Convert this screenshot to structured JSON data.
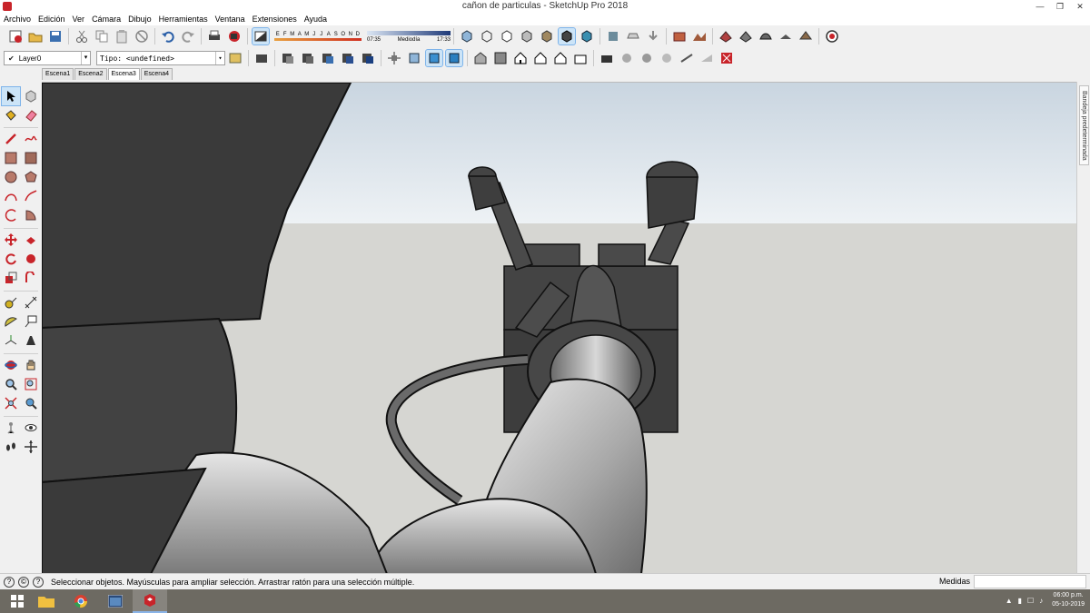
{
  "window": {
    "title": "cañon de particulas - SketchUp Pro 2018"
  },
  "menu": [
    "Archivo",
    "Edición",
    "Ver",
    "Cámara",
    "Dibujo",
    "Herramientas",
    "Ventana",
    "Extensiones",
    "Ayuda"
  ],
  "shadows": {
    "months": [
      "E",
      "F",
      "M",
      "A",
      "M",
      "J",
      "J",
      "A",
      "S",
      "O",
      "N",
      "D"
    ],
    "time_start": "07:35",
    "time_mid": "Mediodía",
    "time_end": "17:33"
  },
  "layer": {
    "current": "Layer0"
  },
  "type_field": {
    "value": "Tipo: <undefined>"
  },
  "scenes": [
    {
      "label": "Escena1",
      "active": false
    },
    {
      "label": "Escena2",
      "active": false
    },
    {
      "label": "Escena3",
      "active": true
    },
    {
      "label": "Escena4",
      "active": false
    }
  ],
  "tray": {
    "label": "Bandeja predeterminada"
  },
  "status": {
    "message": "Seleccionar objetos. Mayúsculas para ampliar selección. Arrastrar ratón para una selección múltiple.",
    "measurements_label": "Medidas",
    "measurements_value": ""
  },
  "taskbar": {
    "time": "06:00 p.m.",
    "date": "05-10-2019"
  },
  "colors": {
    "sky": "#dfe7ee",
    "ground": "#d6d6d2",
    "model_dark": "#3c3c3c",
    "accent": "#c8242a"
  }
}
